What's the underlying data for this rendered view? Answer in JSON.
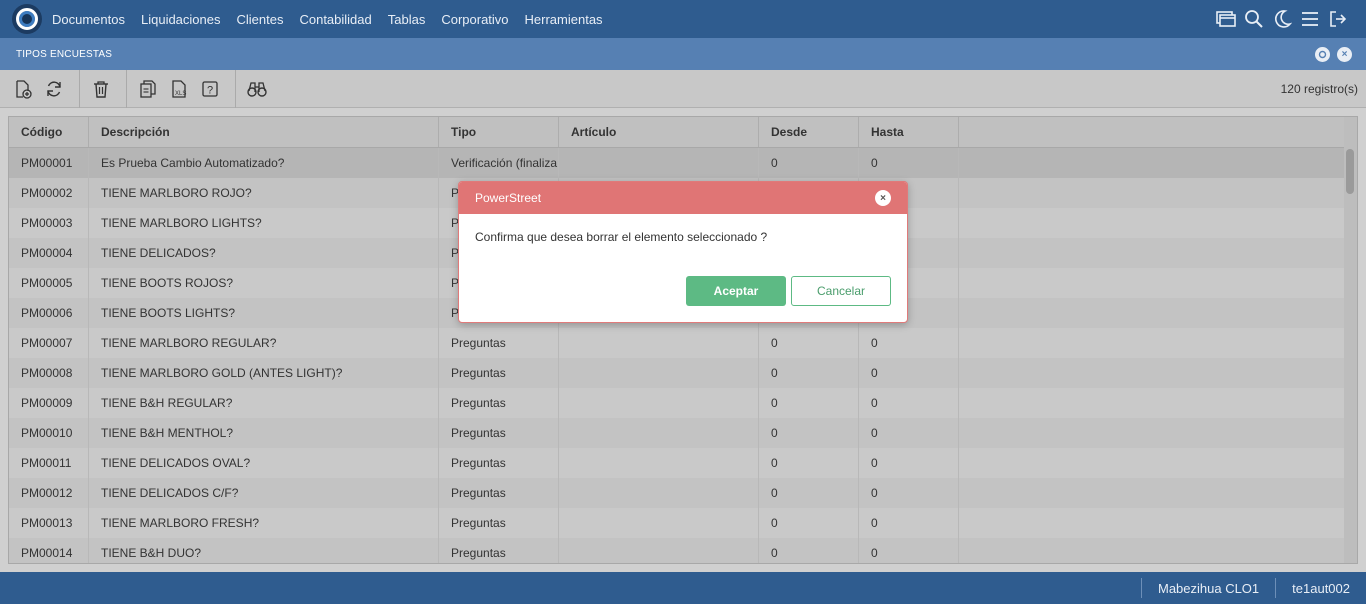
{
  "menu": {
    "items": [
      {
        "label": "Documentos"
      },
      {
        "label": "Liquidaciones"
      },
      {
        "label": "Clientes"
      },
      {
        "label": "Contabilidad"
      },
      {
        "label": "Tablas"
      },
      {
        "label": "Corporativo"
      },
      {
        "label": "Herramientas"
      }
    ],
    "icons": [
      "window-icon",
      "search-icon",
      "moon-icon",
      "hamburger-menu-icon",
      "logout-icon"
    ]
  },
  "window": {
    "title": "TIPOS ENCUESTAS"
  },
  "toolbar": {
    "icons": [
      "new-document-icon",
      "refresh-icon",
      "delete-icon",
      "copy-icon",
      "export-xls-icon",
      "help-icon",
      "binoculars-icon"
    ],
    "record_count": "120 registro(s)"
  },
  "table": {
    "columns": [
      "Código",
      "Descripción",
      "Tipo",
      "Artículo",
      "Desde",
      "Hasta"
    ],
    "rows": [
      {
        "codigo": "PM00001",
        "descripcion": "Es Prueba Cambio Automatizado?",
        "tipo": "Verificación (finaliza",
        "articulo": "",
        "desde": "0",
        "hasta": "0"
      },
      {
        "codigo": "PM00002",
        "descripcion": "TIENE MARLBORO ROJO?",
        "tipo": "P",
        "articulo": "",
        "desde": "",
        "hasta": ""
      },
      {
        "codigo": "PM00003",
        "descripcion": "TIENE MARLBORO LIGHTS?",
        "tipo": "P",
        "articulo": "",
        "desde": "",
        "hasta": ""
      },
      {
        "codigo": "PM00004",
        "descripcion": "TIENE DELICADOS?",
        "tipo": "P",
        "articulo": "",
        "desde": "",
        "hasta": ""
      },
      {
        "codigo": "PM00005",
        "descripcion": "TIENE BOOTS ROJOS?",
        "tipo": "P",
        "articulo": "",
        "desde": "",
        "hasta": ""
      },
      {
        "codigo": "PM00006",
        "descripcion": "TIENE BOOTS LIGHTS?",
        "tipo": "P",
        "articulo": "",
        "desde": "",
        "hasta": ""
      },
      {
        "codigo": "PM00007",
        "descripcion": "TIENE MARLBORO REGULAR?",
        "tipo": "Preguntas",
        "articulo": "",
        "desde": "0",
        "hasta": "0"
      },
      {
        "codigo": "PM00008",
        "descripcion": "TIENE MARLBORO GOLD (ANTES LIGHT)?",
        "tipo": "Preguntas",
        "articulo": "",
        "desde": "0",
        "hasta": "0"
      },
      {
        "codigo": "PM00009",
        "descripcion": "TIENE B&H REGULAR?",
        "tipo": "Preguntas",
        "articulo": "",
        "desde": "0",
        "hasta": "0"
      },
      {
        "codigo": "PM00010",
        "descripcion": "TIENE B&H MENTHOL?",
        "tipo": "Preguntas",
        "articulo": "",
        "desde": "0",
        "hasta": "0"
      },
      {
        "codigo": "PM00011",
        "descripcion": "TIENE DELICADOS OVAL?",
        "tipo": "Preguntas",
        "articulo": "",
        "desde": "0",
        "hasta": "0"
      },
      {
        "codigo": "PM00012",
        "descripcion": "TIENE DELICADOS C/F?",
        "tipo": "Preguntas",
        "articulo": "",
        "desde": "0",
        "hasta": "0"
      },
      {
        "codigo": "PM00013",
        "descripcion": "TIENE MARLBORO FRESH?",
        "tipo": "Preguntas",
        "articulo": "",
        "desde": "0",
        "hasta": "0"
      },
      {
        "codigo": "PM00014",
        "descripcion": "TIENE B&H DUO?",
        "tipo": "Preguntas",
        "articulo": "",
        "desde": "0",
        "hasta": "0"
      }
    ]
  },
  "dialog": {
    "title": "PowerStreet",
    "message": "Confirma que desea borrar el elemento seleccionado ?",
    "accept_label": "Aceptar",
    "cancel_label": "Cancelar",
    "close_icon": "close-icon"
  },
  "status": {
    "user": "Mabezihua CLO1",
    "session": "te1aut002"
  },
  "colors": {
    "topbar": "#2f5c8f",
    "titlebar": "#5680b3",
    "dialog_header": "#e07575",
    "accept_button": "#5dba84"
  }
}
